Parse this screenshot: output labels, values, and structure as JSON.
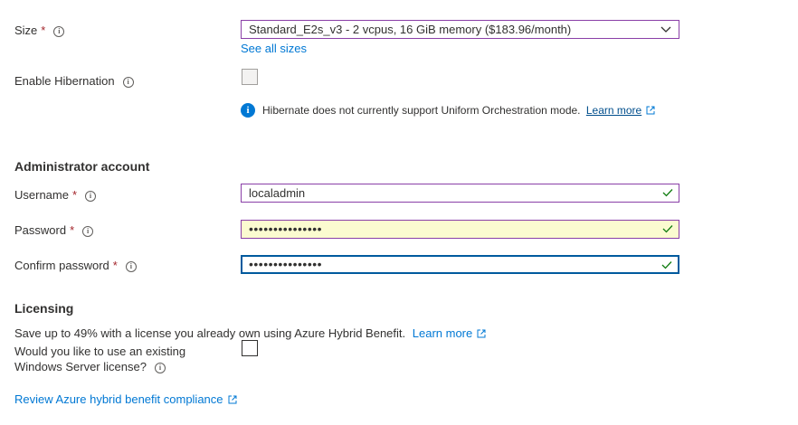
{
  "size": {
    "label": "Size",
    "required": "*",
    "value": "Standard_E2s_v3 - 2 vcpus, 16 GiB memory ($183.96/month)",
    "see_all_link": "See all sizes"
  },
  "hibernation": {
    "label": "Enable Hibernation",
    "checked": false,
    "notice": "Hibernate does not currently support Uniform Orchestration mode.",
    "notice_link": "Learn more"
  },
  "admin": {
    "heading": "Administrator account",
    "username_label": "Username",
    "username_value": "localadmin",
    "password_label": "Password",
    "password_value": "•••••••••••••••",
    "confirm_label": "Confirm password",
    "confirm_value": "•••••••••••••••",
    "required": "*"
  },
  "licensing": {
    "heading": "Licensing",
    "description": "Save up to 49% with a license you already own using Azure Hybrid Benefit.",
    "learn_more": "Learn more",
    "question_line1": "Would you like to use an existing",
    "question_line2": "Windows Server license?",
    "checked": false,
    "compliance_link": "Review Azure hybrid benefit compliance"
  },
  "colors": {
    "link": "#0078d4",
    "required": "#a4262c",
    "valid_border": "#8a3fa7",
    "focus_border": "#005a9e",
    "check_green": "#107c10"
  }
}
